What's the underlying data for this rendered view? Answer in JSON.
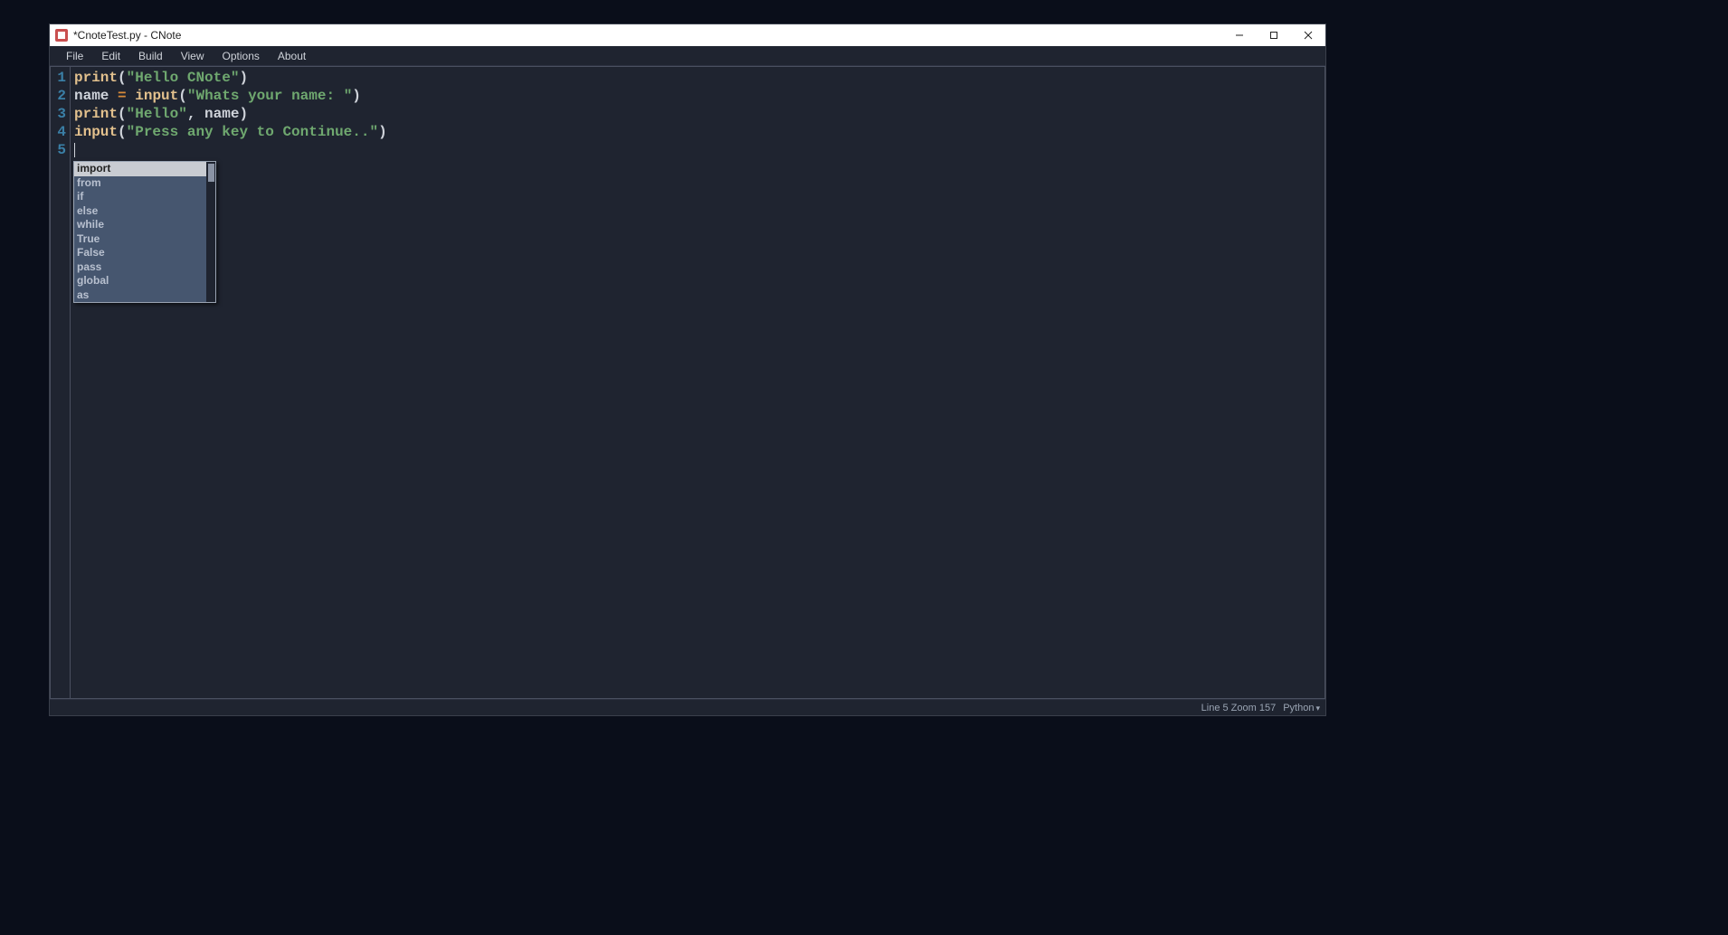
{
  "titlebar": {
    "title": "*CnoteTest.py - CNote"
  },
  "menubar": {
    "items": [
      "File",
      "Edit",
      "Build",
      "View",
      "Options",
      "About"
    ]
  },
  "editor": {
    "lines": [
      {
        "num": "1",
        "tokens": [
          {
            "t": "func",
            "v": "print"
          },
          {
            "t": "punc",
            "v": "("
          },
          {
            "t": "str",
            "v": "\"Hello CNote\""
          },
          {
            "t": "punc",
            "v": ")"
          }
        ]
      },
      {
        "num": "2",
        "tokens": [
          {
            "t": "var",
            "v": "name"
          },
          {
            "t": "var",
            "v": " "
          },
          {
            "t": "op",
            "v": "="
          },
          {
            "t": "var",
            "v": " "
          },
          {
            "t": "func",
            "v": "input"
          },
          {
            "t": "punc",
            "v": "("
          },
          {
            "t": "str",
            "v": "\"Whats your name: \""
          },
          {
            "t": "punc",
            "v": ")"
          }
        ]
      },
      {
        "num": "3",
        "tokens": [
          {
            "t": "func",
            "v": "print"
          },
          {
            "t": "punc",
            "v": "("
          },
          {
            "t": "str",
            "v": "\"Hello\""
          },
          {
            "t": "punc",
            "v": ", "
          },
          {
            "t": "var",
            "v": "name"
          },
          {
            "t": "punc",
            "v": ")"
          }
        ]
      },
      {
        "num": "4",
        "tokens": [
          {
            "t": "func",
            "v": "input"
          },
          {
            "t": "punc",
            "v": "("
          },
          {
            "t": "str",
            "v": "\"Press any key to Continue..\""
          },
          {
            "t": "punc",
            "v": ")"
          }
        ]
      },
      {
        "num": "5",
        "tokens": []
      }
    ]
  },
  "autocomplete": {
    "items": [
      "import",
      "from",
      "if",
      "else",
      "while",
      "True",
      "False",
      "pass",
      "global",
      "as"
    ],
    "selected_index": 0
  },
  "statusbar": {
    "line_info": "Line 5 Zoom 157",
    "language": "Python"
  }
}
